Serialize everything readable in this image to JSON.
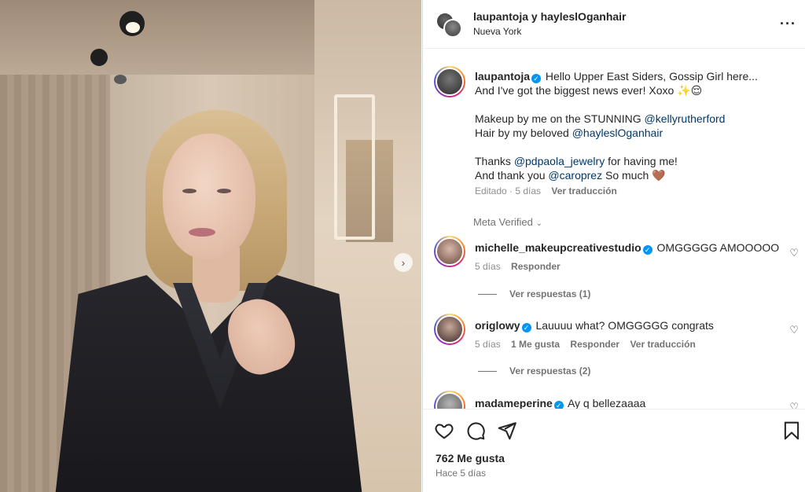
{
  "post": {
    "header_title": "laupantoja y hayleslOganhair",
    "location": "Nueva York",
    "more_icon": "more-horizontal-icon"
  },
  "caption": {
    "username": "laupantoja",
    "line1": "Hello Upper East Siders, Gossip Girl here...",
    "line2": "And I've got the biggest news ever! Xoxo ✨😌",
    "makeup_prefix": "Makeup by me on the STUNNING",
    "makeup_mention": "@kellyrutherford",
    "hair_prefix": "Hair by my beloved",
    "hair_mention": "@hayleslOganhair",
    "thanks_prefix": "Thanks",
    "thanks_mention": "@pdpaola_jewelry",
    "thanks_suffix": "for having me!",
    "thankyou_prefix": "And thank you",
    "thankyou_mention": "@caroprez",
    "thankyou_suffix": "So much 🤎",
    "edited": "Editado · 5 días",
    "translate": "Ver traducción"
  },
  "meta_verified": "Meta Verified",
  "comments": [
    {
      "username": "michelle_makeupcreativestudio",
      "text": "OMGGGGG AMOOOOO",
      "age": "5 días",
      "reply": "Responder",
      "view_replies": "Ver respuestas (1)"
    },
    {
      "username": "origlowy",
      "text": "Lauuuu what? OMGGGGG congrats",
      "age": "5 días",
      "likes": "1 Me gusta",
      "reply": "Responder",
      "translate": "Ver traducción",
      "view_replies": "Ver respuestas (2)"
    },
    {
      "username": "madameperine",
      "text": "Ay q bellezaaaa"
    }
  ],
  "footer": {
    "likes": "762 Me gusta",
    "time": "Hace 5 días"
  },
  "colors": {
    "verified": "#0095f6",
    "link": "#00376b",
    "muted": "#737373"
  }
}
